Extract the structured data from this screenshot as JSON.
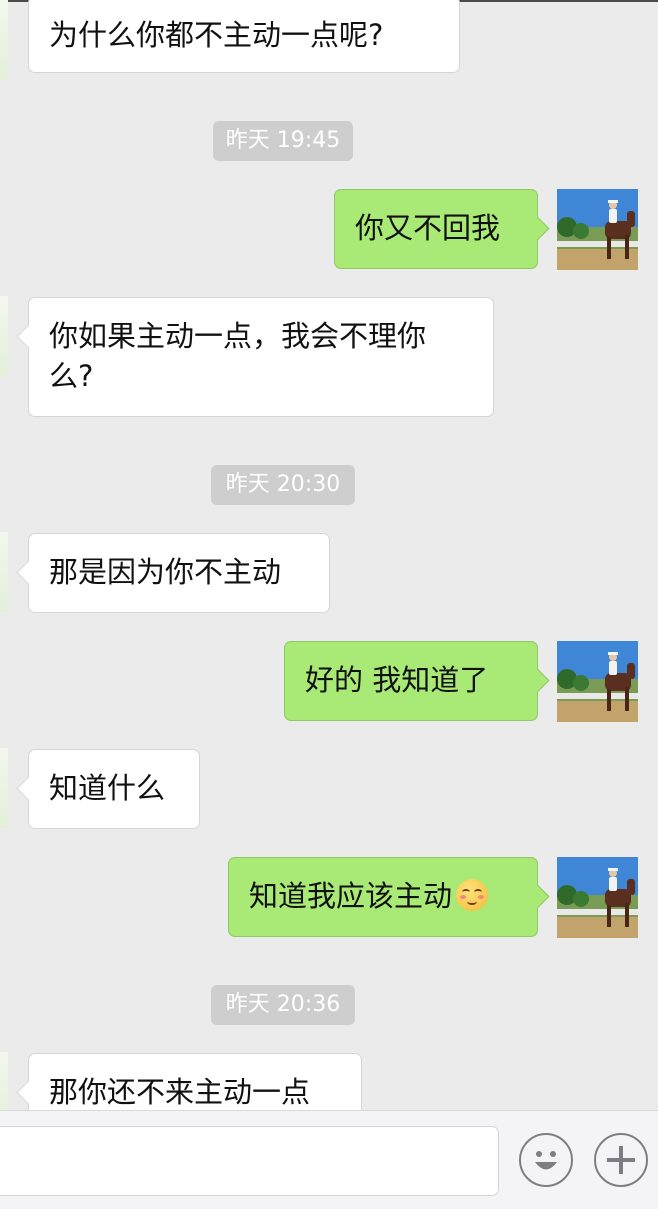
{
  "conversation": {
    "messages": [
      {
        "type": "incoming",
        "text": "为什么你都不主动一点呢?"
      },
      {
        "type": "time",
        "text": "昨天 19:45"
      },
      {
        "type": "outgoing",
        "text": "你又不回我"
      },
      {
        "type": "incoming",
        "lines": [
          "你如果主动一点，我会不理你",
          "么?"
        ]
      },
      {
        "type": "time",
        "text": "昨天 20:30"
      },
      {
        "type": "incoming",
        "text": "那是因为你不主动"
      },
      {
        "type": "outgoing",
        "text": "好的 我知道了"
      },
      {
        "type": "incoming",
        "text": "知道什么"
      },
      {
        "type": "outgoing",
        "text": "知道我应该主动",
        "emoji": "blushing-smile-emoji"
      },
      {
        "type": "time",
        "text": "昨天 20:36"
      },
      {
        "type": "incoming",
        "text": "那你还不来主动一点"
      }
    ]
  },
  "input_bar": {
    "message_value": "",
    "emoji_button_icon": "smiley-face-icon",
    "more_button_icon": "plus-icon"
  },
  "colors": {
    "background": "#ebebeb",
    "outgoing_bubble": "#a9e975",
    "incoming_bubble": "#ffffff",
    "time_badge": "#cecece"
  }
}
